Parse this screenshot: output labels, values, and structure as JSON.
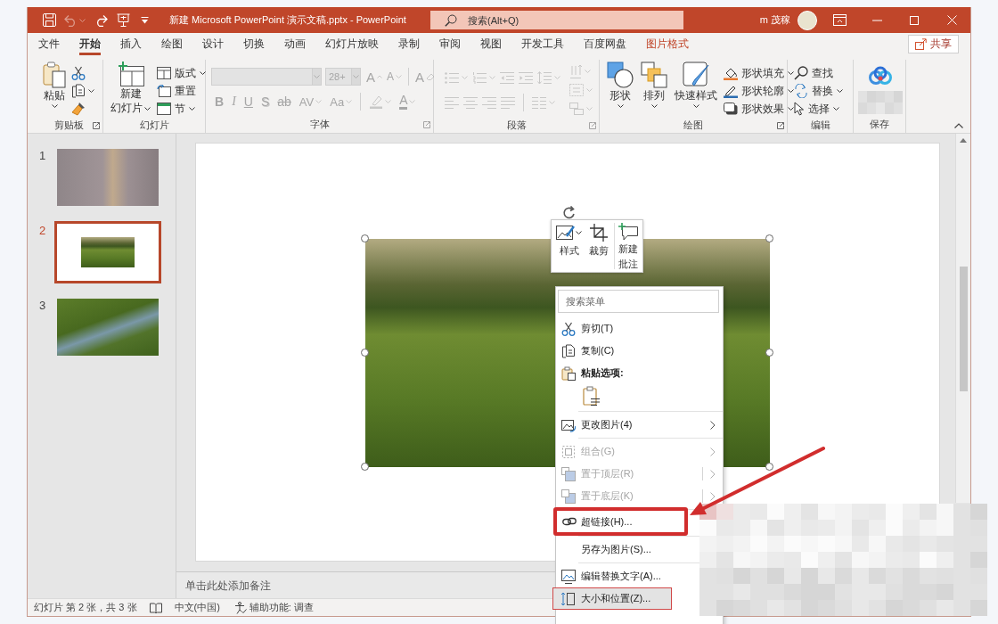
{
  "title_bar": {
    "quick_access": [
      {
        "disabled": false
      },
      {
        "disabled": true
      },
      {
        "disabled": false
      },
      {
        "disabled": false
      },
      {
        "disabled": false
      }
    ],
    "title": "新建 Microsoft PowerPoint 演示文稿.pptx - PowerPoint",
    "search": {
      "placeholder": "搜索(Alt+Q)"
    },
    "user": "m 茂稼"
  },
  "menu_tabs": [
    {
      "label": "文件",
      "kind": "standard",
      "selected": false
    },
    {
      "label": "开始",
      "kind": "standard",
      "selected": true
    },
    {
      "label": "插入",
      "kind": "standard",
      "selected": false
    },
    {
      "label": "绘图",
      "kind": "standard",
      "selected": false
    },
    {
      "label": "设计",
      "kind": "standard",
      "selected": false
    },
    {
      "label": "切换",
      "kind": "standard",
      "selected": false
    },
    {
      "label": "动画",
      "kind": "standard",
      "selected": false
    },
    {
      "label": "幻灯片放映",
      "kind": "standard",
      "selected": false
    },
    {
      "label": "录制",
      "kind": "standard",
      "selected": false
    },
    {
      "label": "审阅",
      "kind": "standard",
      "selected": false
    },
    {
      "label": "视图",
      "kind": "standard",
      "selected": false
    },
    {
      "label": "开发工具",
      "kind": "standard",
      "selected": false
    },
    {
      "label": "百度网盘",
      "kind": "standard",
      "selected": false
    },
    {
      "label": "图片格式",
      "kind": "contextual",
      "selected": false
    }
  ],
  "share_button": {
    "label": "共享"
  },
  "ribbon": [
    {
      "kind": "clipboard",
      "label": "剪贴板",
      "launcher": true,
      "disabled": false,
      "paste": "粘贴"
    },
    {
      "kind": "slides",
      "label": "幻灯片",
      "launcher": false,
      "disabled": false,
      "new_slide": [
        "新建",
        "幻灯片"
      ],
      "small": [
        {
          "label": "版式",
          "dropdown": true
        },
        {
          "label": "重置",
          "dropdown": false
        },
        {
          "label": "节",
          "dropdown": true
        }
      ]
    },
    {
      "kind": "font",
      "label": "字体",
      "launcher": true,
      "disabled": true,
      "size": "28+",
      "grow": "A",
      "shrink": "A",
      "clear": "A",
      "styles": [
        "B",
        "I",
        "U",
        "S",
        "ab",
        "AV",
        "Aa"
      ],
      "color_letter": "A"
    },
    {
      "kind": "paragraph",
      "label": "段落",
      "launcher": true,
      "disabled": true
    },
    {
      "kind": "drawing",
      "label": "绘图",
      "launcher": true,
      "disabled": false,
      "large": [
        "形状",
        "排列",
        "快速样式"
      ],
      "small": [
        {
          "label": "形状填充",
          "dropdown": true
        },
        {
          "label": "形状轮廓",
          "dropdown": true
        },
        {
          "label": "形状效果",
          "dropdown": true
        }
      ]
    },
    {
      "kind": "editing",
      "label": "编辑",
      "launcher": false,
      "disabled": false,
      "small": [
        {
          "label": "查找",
          "dropdown": false
        },
        {
          "label": "替换",
          "dropdown": true
        },
        {
          "label": "选择",
          "dropdown": true
        }
      ]
    },
    {
      "kind": "save",
      "label": "保存",
      "launcher": false,
      "disabled": false
    }
  ],
  "slides": [
    {
      "number": "1",
      "kind": "photo",
      "selected": false
    },
    {
      "number": "2",
      "kind": "inset",
      "selected": true
    },
    {
      "number": "3",
      "kind": "photo",
      "selected": false
    }
  ],
  "notes": {
    "placeholder": "单击此处添加备注"
  },
  "status_bar": {
    "slide_info": "幻灯片 第 2 张，共 3 张",
    "language": "中文(中国)",
    "accessibility": "辅助功能: 调查"
  },
  "mini_toolbar": [
    {
      "lines": [
        "样式"
      ],
      "dropdown": true
    },
    {
      "lines": [
        "裁剪"
      ],
      "dropdown": false
    },
    {
      "lines": [
        "新建",
        "批注"
      ],
      "dropdown": false
    }
  ],
  "context_menu": {
    "search": {
      "placeholder": "搜索菜单"
    },
    "items": [
      {
        "kind": "command",
        "label": "剪切(T)",
        "disabled": false,
        "selected": false
      },
      {
        "kind": "command",
        "label": "复制(C)",
        "disabled": false,
        "selected": false
      },
      {
        "kind": "heading",
        "label": "粘贴选项:"
      },
      {
        "kind": "paste_option"
      },
      {
        "kind": "separator"
      },
      {
        "kind": "command",
        "label": "更改图片(4)",
        "disabled": false,
        "selected": false,
        "submenu": true
      },
      {
        "kind": "separator"
      },
      {
        "kind": "command",
        "label": "组合(G)",
        "disabled": true,
        "selected": false,
        "submenu": true
      },
      {
        "kind": "command",
        "label": "置于顶层(R)",
        "disabled": true,
        "selected": false,
        "submenu": true,
        "split": true
      },
      {
        "kind": "command",
        "label": "置于底层(K)",
        "disabled": true,
        "selected": false,
        "submenu": true,
        "split": true
      },
      {
        "kind": "separator"
      },
      {
        "kind": "command",
        "label": "超链接(H)...",
        "disabled": false,
        "selected": false,
        "pointed_out": true
      },
      {
        "kind": "separator"
      },
      {
        "kind": "command",
        "label": "另存为图片(S)...",
        "disabled": false,
        "selected": false
      },
      {
        "kind": "separator"
      },
      {
        "kind": "command",
        "label": "编辑替换文字(A)...",
        "disabled": false,
        "selected": false
      },
      {
        "kind": "command",
        "label": "大小和位置(Z)...",
        "disabled": false,
        "selected": true,
        "outlined": true
      }
    ]
  }
}
